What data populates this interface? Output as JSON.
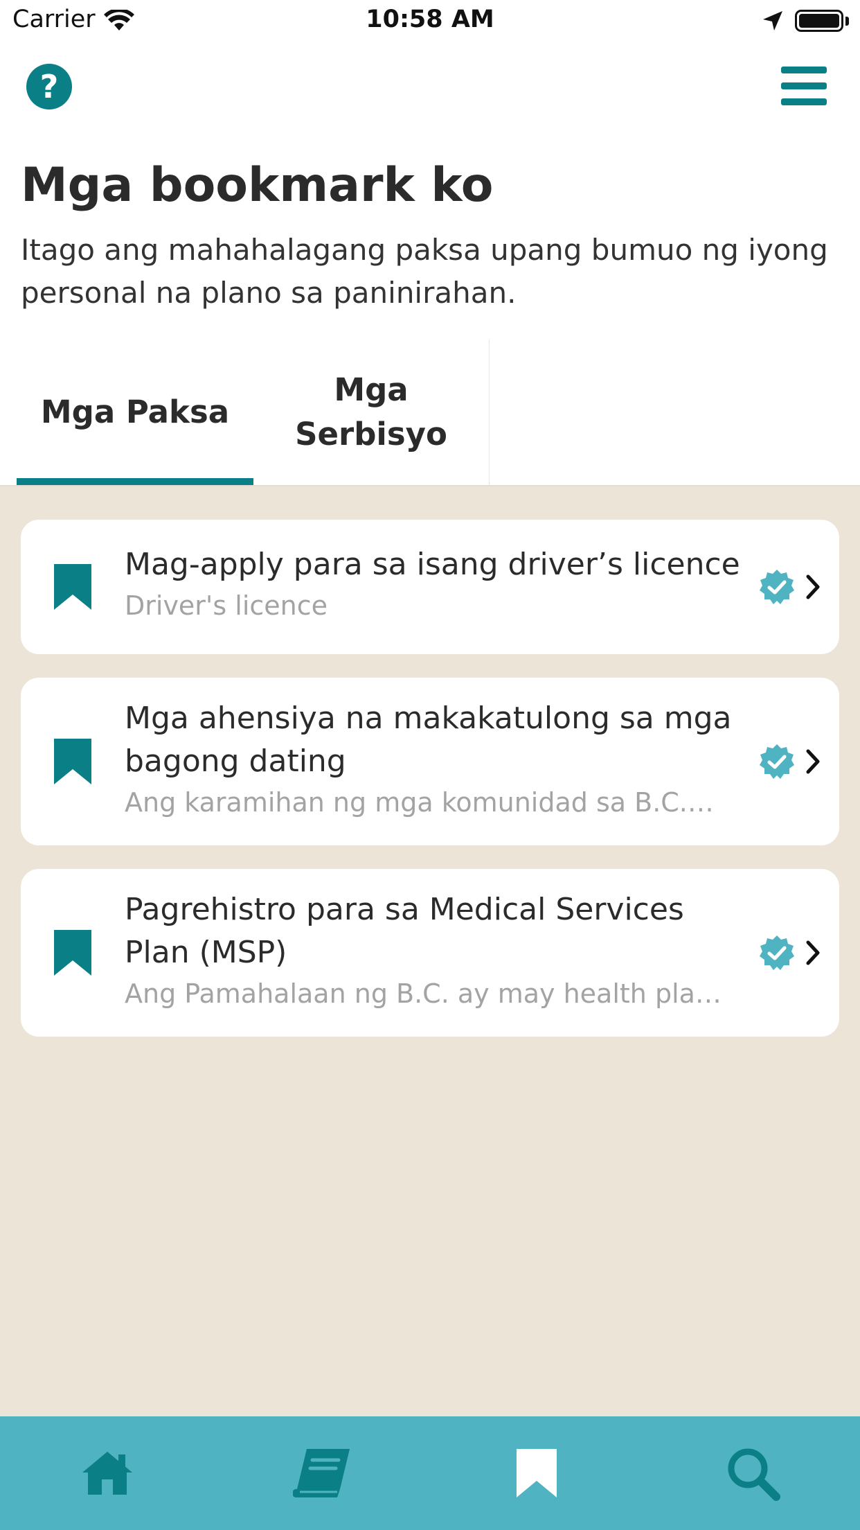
{
  "status_bar": {
    "carrier": "Carrier",
    "time": "10:58 AM"
  },
  "header": {
    "help_icon_glyph": "?",
    "title": "Mga bookmark ko",
    "subtitle": "Itago ang mahahalagang paksa upang bumuo ng iyong personal na plano sa paninirahan."
  },
  "tabs": [
    {
      "label": "Mga Paksa",
      "selected": true
    },
    {
      "label": "Mga Serbisyo",
      "selected": false
    }
  ],
  "bookmarks": [
    {
      "title": "Mag-apply para sa isang driver’s licence",
      "subtitle": "Driver's licence"
    },
    {
      "title": "Mga ahensiya na makakatulong sa mga bagong dating",
      "subtitle": "Ang karamihan ng mga komunidad sa B.C.…"
    },
    {
      "title": "Pagrehistro para sa Medical Services Plan (MSP)",
      "subtitle": "Ang Pamahalaan ng B.C. ay may health pla…"
    }
  ],
  "nav": [
    {
      "name": "home",
      "icon": "home-icon"
    },
    {
      "name": "learn",
      "icon": "book-icon"
    },
    {
      "name": "bookmarks",
      "icon": "bookmark-icon",
      "selected": true
    },
    {
      "name": "search",
      "icon": "search-icon"
    }
  ],
  "colors": {
    "accent": "#0a7f86",
    "nav_bg": "#4fb3c1",
    "content_bg": "#ede4d8",
    "verified": "#4fb3c1"
  }
}
